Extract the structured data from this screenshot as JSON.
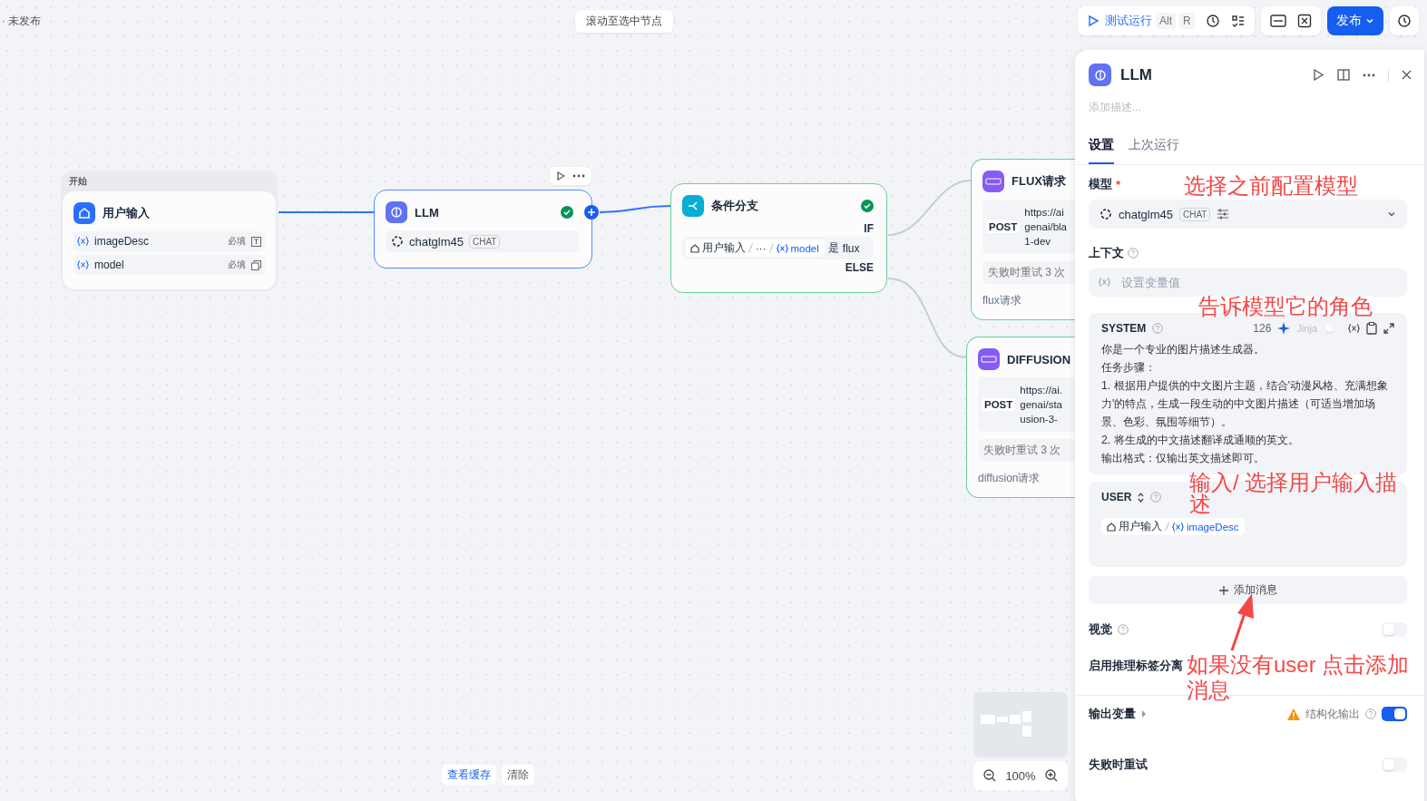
{
  "status": "· 未发布",
  "scroll_button": "滚动至选中节点",
  "toolbar": {
    "test_run": "测试运行",
    "keys": [
      "Alt",
      "R"
    ],
    "publish": "发布"
  },
  "nodes": {
    "start": {
      "group_label": "开始",
      "title": "用户输入",
      "variables": [
        {
          "name": "imageDesc",
          "required": "必填",
          "kind": "text"
        },
        {
          "name": "model",
          "required": "必填",
          "kind": "select"
        }
      ]
    },
    "llm": {
      "title": "LLM",
      "model": "chatglm45",
      "tag": "CHAT",
      "ok": true
    },
    "condition": {
      "title": "条件分支",
      "ok": true,
      "if_label": "IF",
      "source": "用户输入",
      "ellipsis": "···",
      "variable": "model",
      "operator": "是",
      "value": "flux",
      "else_label": "ELSE"
    },
    "http": [
      {
        "title": "FLUX请求",
        "method": "POST",
        "url_lines": [
          "https://ai",
          "genai/bla",
          "1-dev"
        ],
        "retry": "失败时重试 3 次",
        "description": "flux请求"
      },
      {
        "title": "DIFFUSION",
        "method": "POST",
        "url_lines": [
          "https://ai.",
          "genai/sta",
          "usion-3-"
        ],
        "retry": "失败时重试 3 次",
        "description": "diffusion请求"
      }
    ]
  },
  "bottom": {
    "view_cache": "查看缓存",
    "clear": "清除",
    "zoom": "100%"
  },
  "panel": {
    "title": "LLM",
    "description_placeholder": "添加描述...",
    "tabs": [
      {
        "label": "设置",
        "selected": true
      },
      {
        "label": "上次运行",
        "selected": false
      }
    ],
    "model_label": "模型",
    "required_mark": "*",
    "model": "chatglm45",
    "model_tag": "CHAT",
    "context_label": "上下文",
    "context_placeholder": "设置变量值",
    "system": {
      "role": "SYSTEM",
      "count": "126",
      "jinja": "Jinja",
      "jinja_on": false,
      "lines": [
        "你是一个专业的图片描述生成器。",
        "任务步骤：",
        "1. 根据用户提供的中文图片主题，结合'动漫风格、充满想象力'的特点，生成一段生动的中文图片描述（可适当增加场景、色彩、氛围等细节）。",
        "2. 将生成的中文描述翻译成通顺的英文。",
        "输出格式：仅输出英文描述即可。"
      ]
    },
    "user": {
      "role": "USER",
      "source": "用户输入",
      "variable": "imageDesc"
    },
    "add_message": "添加消息",
    "settings": [
      {
        "kind": "toggle",
        "label": "视觉",
        "on": false
      },
      {
        "kind": "label",
        "label": "启用推理标签分离"
      }
    ],
    "output_label": "输出变量",
    "structured_label": "结构化输出",
    "structured_on": true,
    "retry_label": "失败时重试",
    "retry_on": false
  },
  "annotations": [
    "选择之前配置模型",
    "告诉模型它的角色",
    "输入/ 选择用户输入描述",
    "如果没有user 点击添加消息"
  ]
}
